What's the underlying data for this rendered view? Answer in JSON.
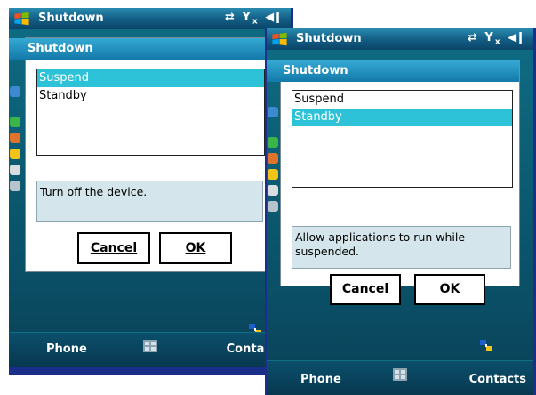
{
  "screens": [
    {
      "titlebar": {
        "title": "Shutdown"
      },
      "dialog": {
        "title": "Shutdown",
        "options": [
          "Suspend",
          "Standby"
        ],
        "selected": "Suspend",
        "description": "Turn off the device.",
        "cancel_label": "Cancel",
        "ok_label": "OK"
      },
      "softkeys": {
        "left": "Phone",
        "right": "Contacts"
      }
    },
    {
      "titlebar": {
        "title": "Shutdown"
      },
      "dialog": {
        "title": "Shutdown",
        "options": [
          "Suspend",
          "Standby"
        ],
        "selected": "Standby",
        "description": "Allow applications to run while suspended.",
        "cancel_label": "Cancel",
        "ok_label": "OK"
      },
      "softkeys": {
        "left": "Phone",
        "right": "Contacts"
      }
    }
  ],
  "colors": {
    "selection": "#2dc2d8",
    "titlebar": "#135f86",
    "background": "#0b5c73",
    "description_box": "#d4e6ec"
  },
  "icons": {
    "start": "windows-flag-icon",
    "connectivity": "sync-arrows-icon",
    "signal": "no-signal-icon",
    "volume": "speaker-icon",
    "tray": "network-icon",
    "sip": "keyboard-icon"
  }
}
